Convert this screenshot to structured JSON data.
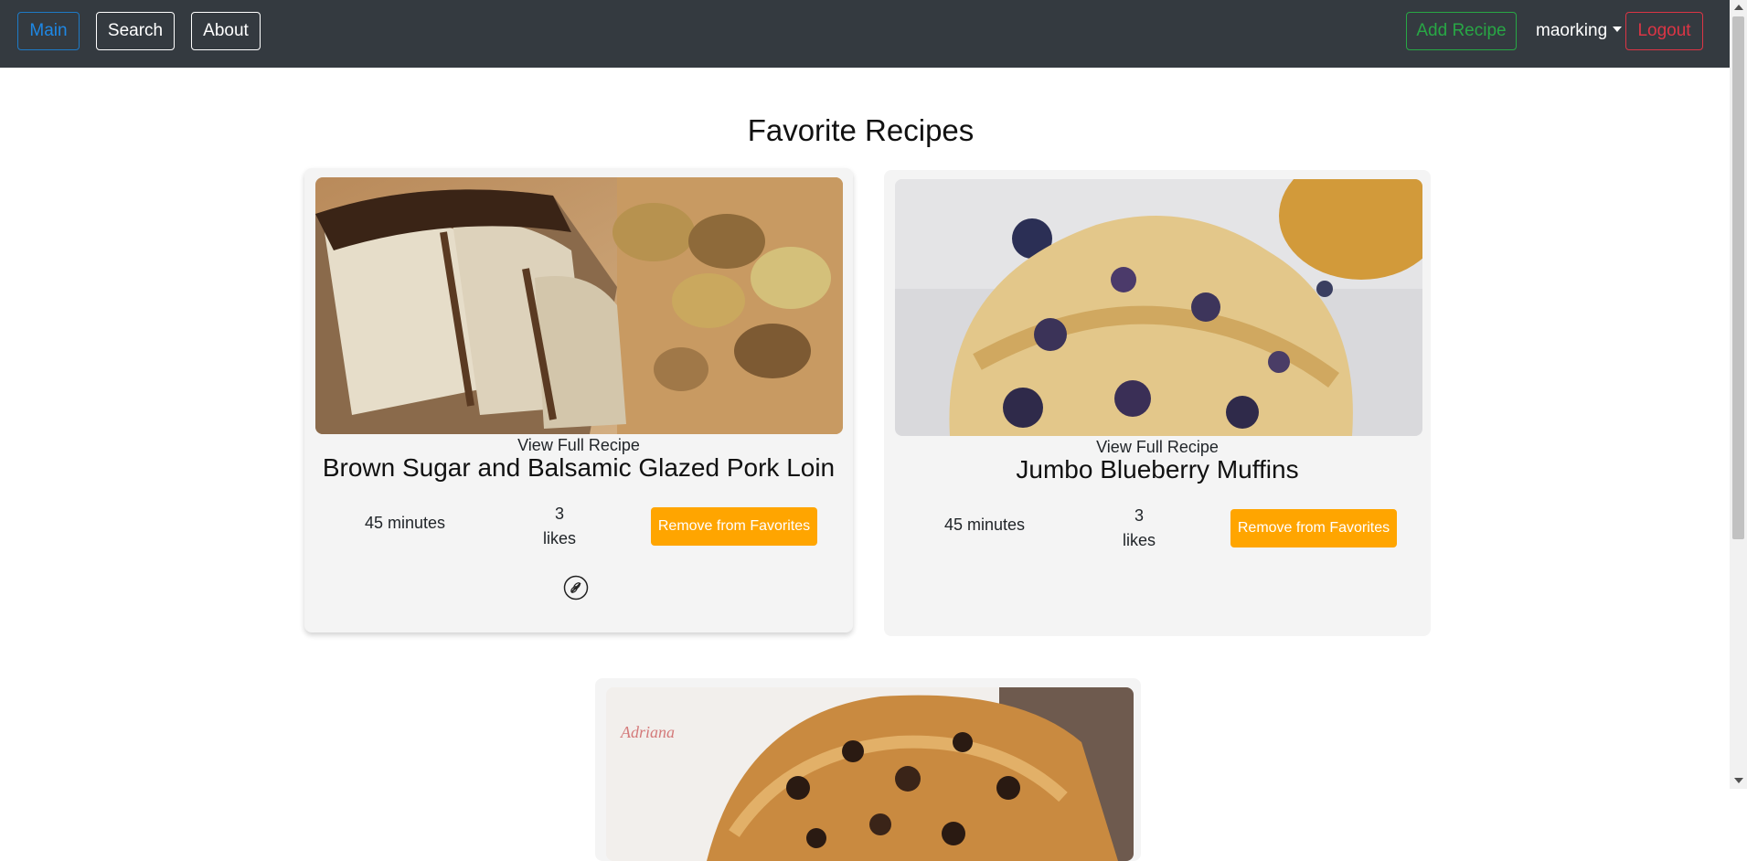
{
  "nav": {
    "main": "Main",
    "search": "Search",
    "about": "About",
    "add_recipe": "Add Recipe",
    "user": "maorking",
    "logout": "Logout"
  },
  "page": {
    "title": "Favorite Recipes"
  },
  "recipes": [
    {
      "view_label": "View Full Recipe",
      "title": "Brown Sugar and Balsamic Glazed Pork Loin",
      "time": "45 minutes",
      "likes_count": "3",
      "likes_label": "likes",
      "action_label": "Remove from Favorites",
      "image": "glazed pork loin with roasted potatoes"
    },
    {
      "view_label": "View Full Recipe",
      "title": "Jumbo Blueberry Muffins",
      "time": "45 minutes",
      "likes_count": "3",
      "likes_label": "likes",
      "action_label": "Remove from Favorites",
      "image": "blueberry muffin with crumb topping"
    },
    {
      "image": "chocolate chip cookie bars",
      "watermark": "Adriana"
    }
  ],
  "colors": {
    "navbar": "#343a40",
    "main_button": "#1e88e5",
    "add_button": "#28a745",
    "logout_button": "#dc3545",
    "remove_button": "#ffa500",
    "card_bg": "#f4f4f4"
  }
}
